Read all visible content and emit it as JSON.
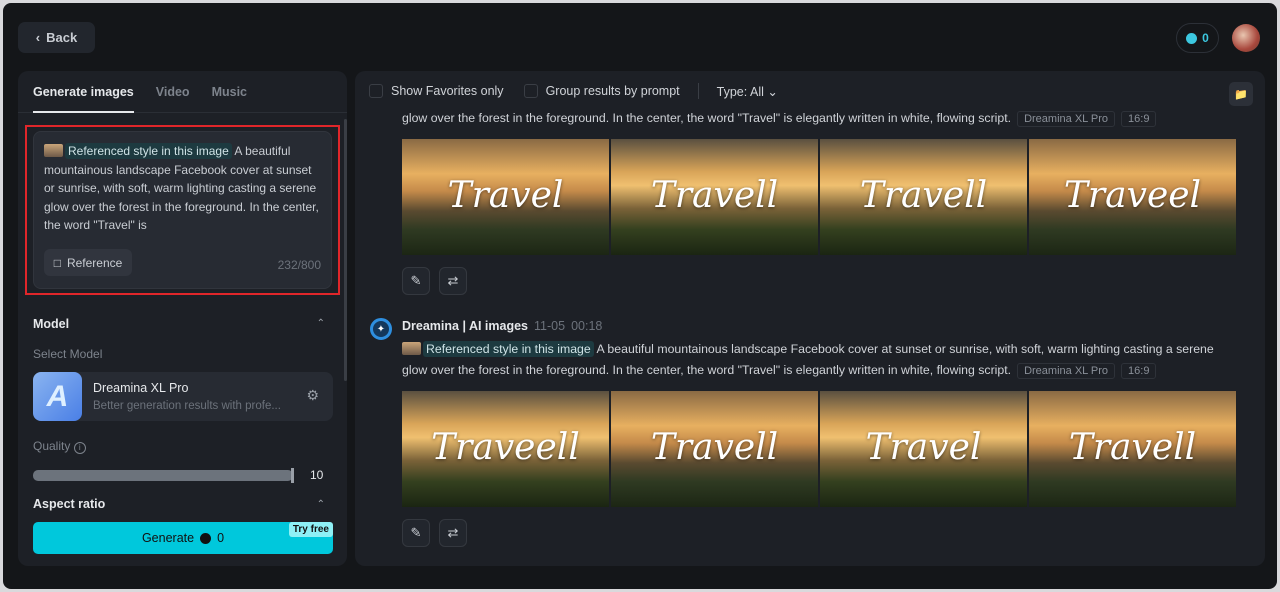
{
  "header": {
    "back_label": "Back",
    "credits": "0"
  },
  "left": {
    "tabs": [
      {
        "label": "Generate images"
      },
      {
        "label": "Video"
      },
      {
        "label": "Music"
      }
    ],
    "prompt": {
      "chip": "Referenced style in this image",
      "text": "A beautiful mountainous landscape Facebook cover at sunset or sunrise, with soft, warm lighting casting a serene glow over the forest in the foreground. In the center, the word \"Travel\" is",
      "reference_label": "Reference",
      "count": "232/800"
    },
    "model_section": "Model",
    "select_model": "Select Model",
    "model": {
      "name": "Dreamina XL Pro",
      "desc": "Better generation results with profe...",
      "logo": "A"
    },
    "quality_label": "Quality",
    "quality_value": "10",
    "quality_fraction": 1.0,
    "aspect_label": "Aspect ratio",
    "generate_label": "Generate",
    "generate_cost": "0",
    "try_free": "Try free"
  },
  "right": {
    "filters": {
      "favorites": "Show Favorites only",
      "group": "Group results by prompt",
      "type": "Type: All"
    },
    "results": [
      {
        "line2": "glow over the forest in the foreground. In the center, the word \"Travel\" is elegantly written in white, flowing script.",
        "model": "Dreamina XL Pro",
        "ratio": "16:9",
        "images": [
          "Travel",
          "Travell",
          "Travell",
          "Traveel"
        ]
      },
      {
        "author": "Dreamina | AI images",
        "date": "11-05",
        "time": "00:18",
        "chip": "Referenced style in this image",
        "line1": "A beautiful mountainous landscape Facebook cover at sunset or sunrise, with soft, warm lighting casting a serene",
        "line2": "glow over the forest in the foreground. In the center, the word \"Travel\" is elegantly written in white, flowing script.",
        "model": "Dreamina XL Pro",
        "ratio": "16:9",
        "images": [
          "Traveell",
          "Travell",
          "Travel",
          "Travell"
        ]
      }
    ]
  },
  "colors": {
    "accent": "#00c8dc",
    "highlight_border": "#e0262a"
  }
}
